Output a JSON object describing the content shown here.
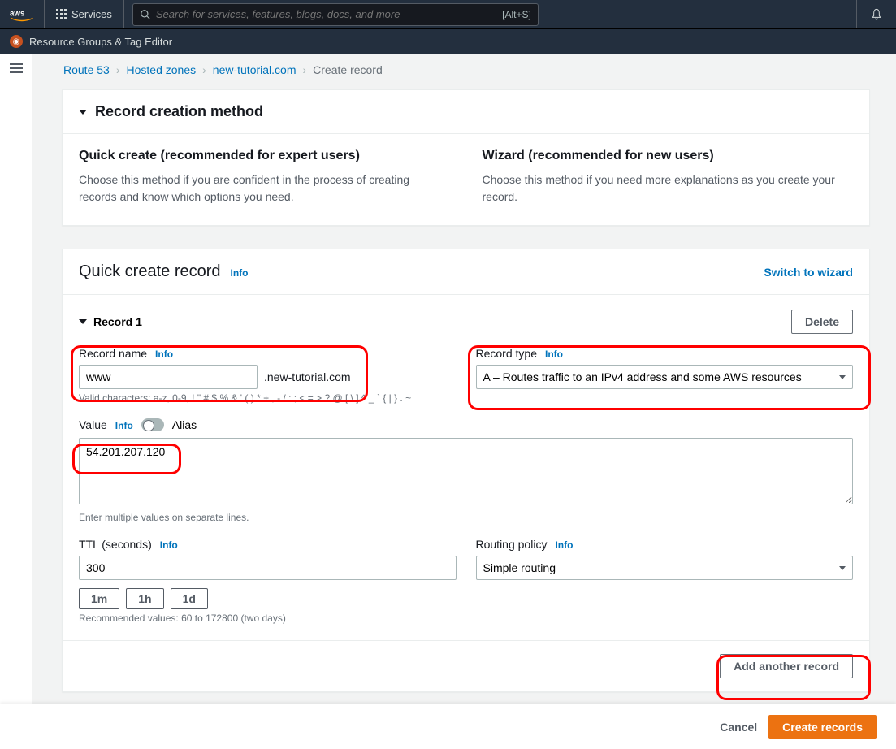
{
  "nav": {
    "services": "Services",
    "search_placeholder": "Search for services, features, blogs, docs, and more",
    "search_shortcut": "[Alt+S]",
    "resource_groups": "Resource Groups & Tag Editor"
  },
  "breadcrumb": {
    "items": [
      "Route 53",
      "Hosted zones",
      "new-tutorial.com"
    ],
    "current": "Create record"
  },
  "method_panel": {
    "title": "Record creation method",
    "quick": {
      "title": "Quick create (recommended for expert users)",
      "desc": "Choose this method if you are confident in the process of creating records and know which options you need."
    },
    "wizard": {
      "title": "Wizard (recommended for new users)",
      "desc": "Choose this method if you need more explanations as you create your record."
    }
  },
  "quick_create": {
    "title": "Quick create record",
    "info": "Info",
    "switch": "Switch to wizard"
  },
  "record": {
    "title": "Record 1",
    "delete": "Delete",
    "name_label": "Record name",
    "name_value": "www",
    "name_suffix": ".new-tutorial.com",
    "name_hint": "Valid characters: a-z, 0-9, ! \" # $ % & ' ( ) * + , - / : ; < = > ? @ [ \\ ] ^ _ ` { | } . ~",
    "type_label": "Record type",
    "type_value": "A – Routes traffic to an IPv4 address and some AWS resources",
    "value_label": "Value",
    "alias_label": "Alias",
    "value_text": "54.201.207.120",
    "value_hint": "Enter multiple values on separate lines.",
    "ttl_label": "TTL (seconds)",
    "ttl_value": "300",
    "ttl_1m": "1m",
    "ttl_1h": "1h",
    "ttl_1d": "1d",
    "ttl_hint": "Recommended values: 60 to 172800 (two days)",
    "routing_label": "Routing policy",
    "routing_value": "Simple routing",
    "add_another": "Add another record"
  },
  "footer": {
    "cancel": "Cancel",
    "create": "Create records"
  }
}
